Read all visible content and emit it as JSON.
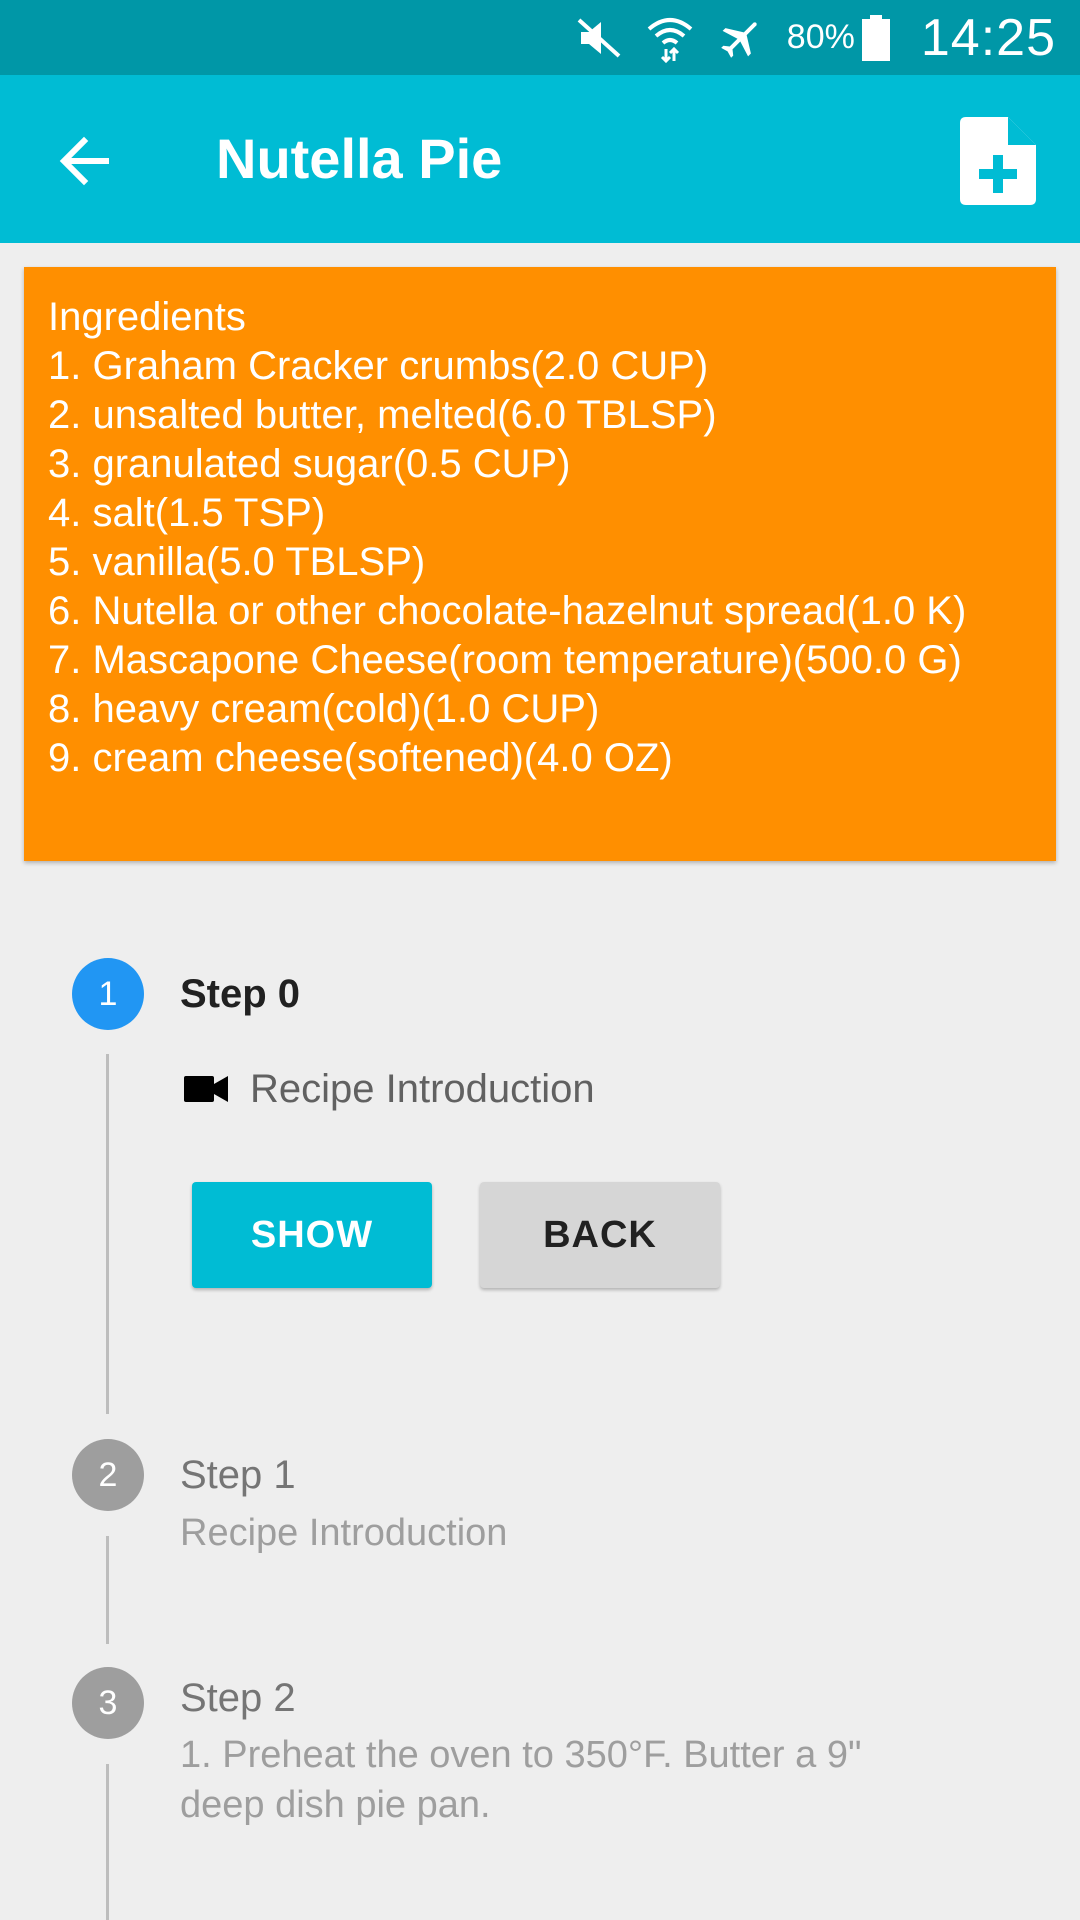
{
  "status_bar": {
    "battery": "80%",
    "time": "14:25",
    "icons": [
      "mute-icon",
      "wifi-icon",
      "airplane-icon",
      "battery-icon"
    ]
  },
  "app_bar": {
    "title": "Nutella Pie",
    "back_icon": "arrow-back-icon",
    "action_icon": "add-file-icon"
  },
  "ingredients": {
    "heading": "Ingredients",
    "items": [
      "1. Graham Cracker crumbs(2.0 CUP)",
      "2. unsalted butter, melted(6.0 TBLSP)",
      "3. granulated sugar(0.5 CUP)",
      "4. salt(1.5 TSP)",
      "5. vanilla(5.0 TBLSP)",
      "6. Nutella or other chocolate-hazelnut spread(1.0 K)",
      "7. Mascapone Cheese(room temperature)(500.0 G)",
      "8. heavy cream(cold)(1.0 CUP)",
      "9. cream cheese(softened)(4.0 OZ)"
    ]
  },
  "steps": [
    {
      "number": "1",
      "title": "Step 0",
      "media_icon": "videocam-icon",
      "media_label": "Recipe Introduction",
      "show_label": "SHOW",
      "back_label": "BACK"
    },
    {
      "number": "2",
      "title": "Step 1",
      "subtitle": "Recipe Introduction"
    },
    {
      "number": "3",
      "title": "Step 2",
      "subtitle_line1": "1. Preheat the oven to 350°F. Butter a 9\"",
      "subtitle_line2": "deep dish pie pan."
    }
  ],
  "colors": {
    "status_bar": "#0097a7",
    "app_bar": "#00bcd4",
    "ingredients_card": "#ff8f00",
    "active_step": "#2196f3",
    "inactive_step": "#9e9e9e",
    "show_button": "#00bcd4",
    "back_button": "#d6d6d6"
  }
}
